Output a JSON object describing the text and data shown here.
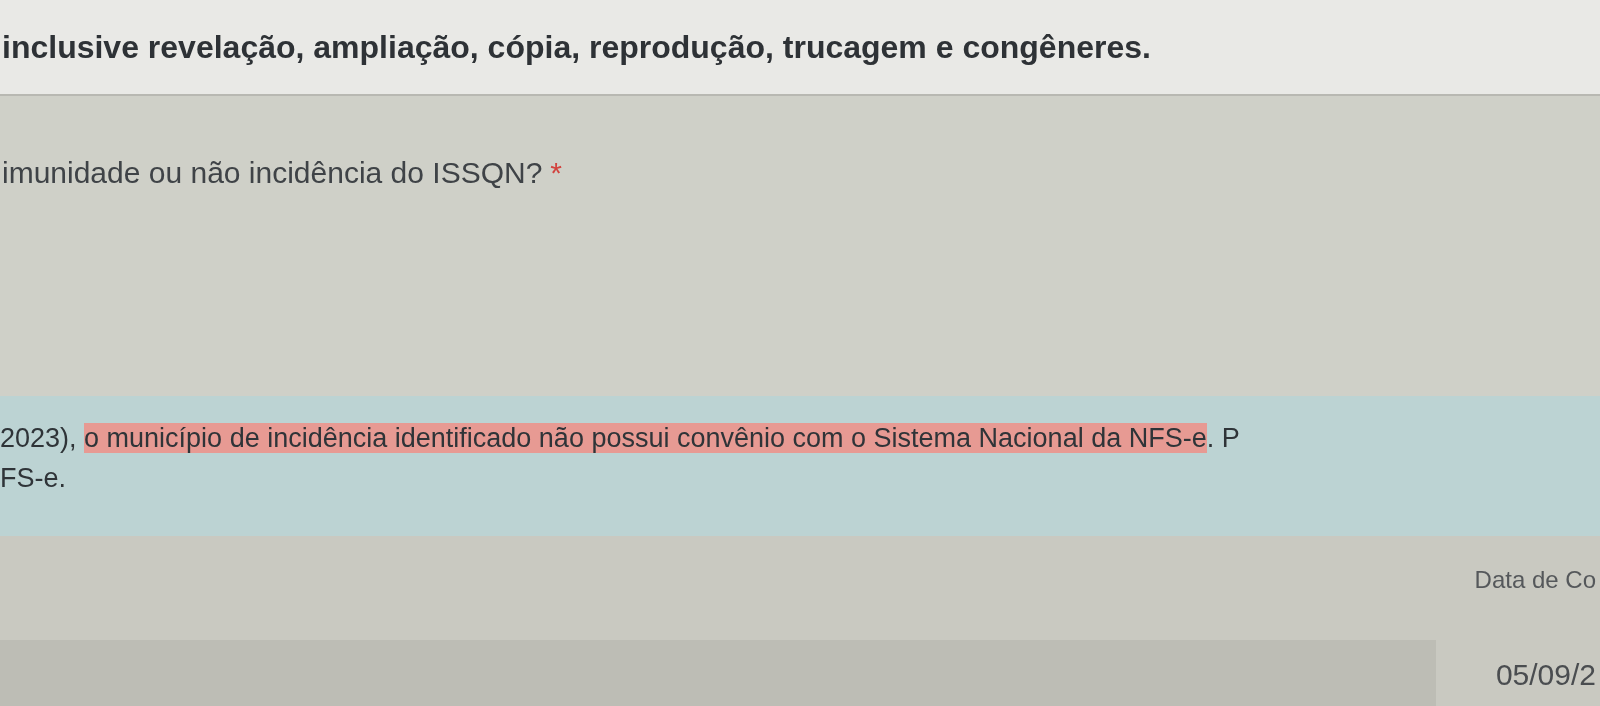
{
  "service_description": {
    "text": "inclusive revelação, ampliação, cópia, reprodução, trucagem e congêneres."
  },
  "question": {
    "label": "imunidade ou não incidência do ISSQN?",
    "required_mark": "*"
  },
  "notice": {
    "line_1": [
      {
        "text": "2023), ",
        "highlighted": false
      },
      {
        "text": "o município de incidência identificado não possui convênio com o Sistema Nacional da NFS-e",
        "highlighted": true
      },
      {
        "text": ". P",
        "highlighted": false
      }
    ],
    "line_2": "FS-e."
  },
  "date_field": {
    "label": "Data de Co",
    "value": "05/09/2"
  }
}
